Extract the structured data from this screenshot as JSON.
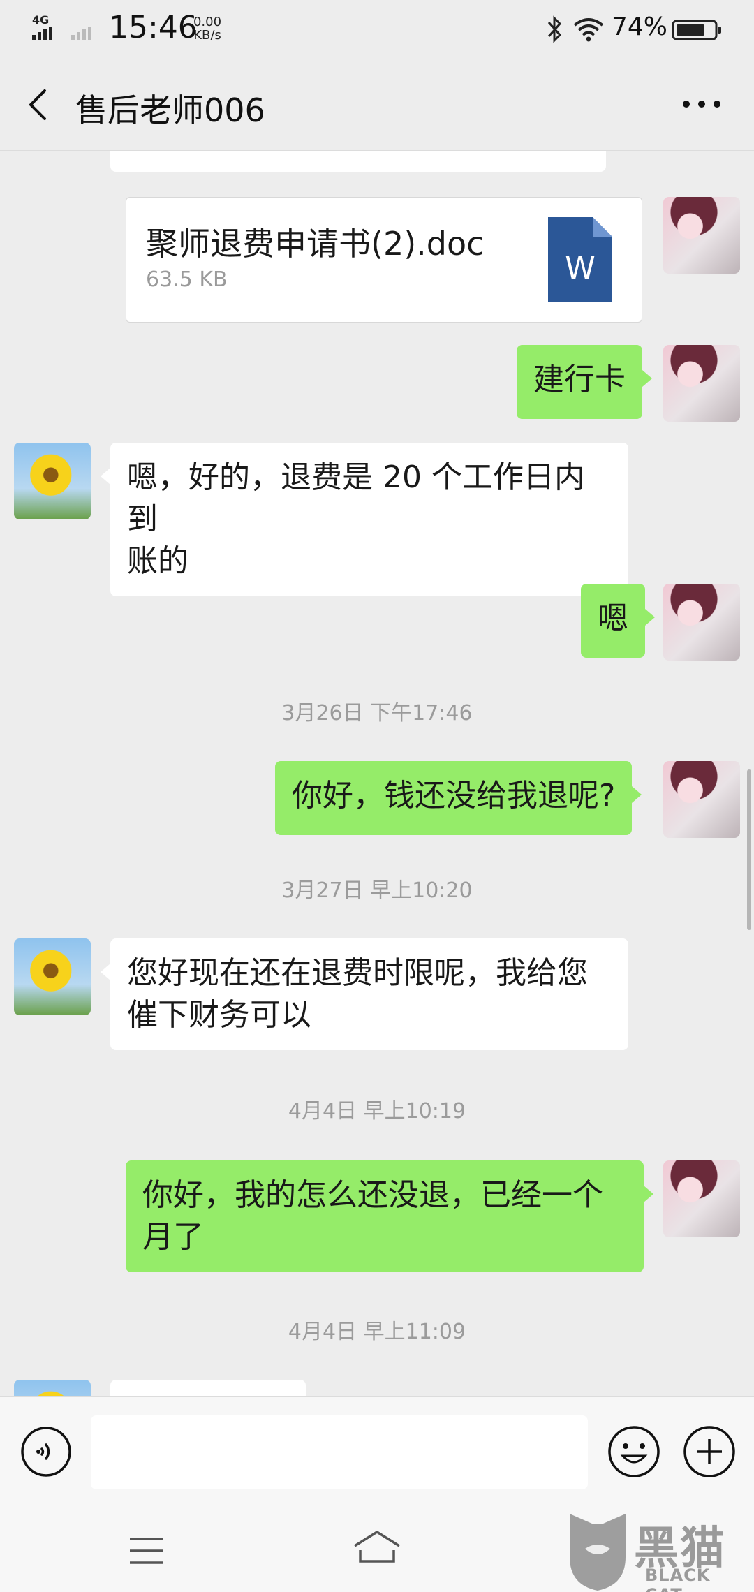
{
  "status_bar": {
    "network": "4G",
    "time": "15:46",
    "speed_value": "0.00",
    "speed_unit": "KB/s",
    "battery_percent": "74%"
  },
  "nav": {
    "title": "售后老师006",
    "back_icon": "chevron-left-icon",
    "more_icon": "more-dots-icon"
  },
  "messages": [
    {
      "type": "file",
      "side": "right",
      "file_name": "聚师退费申请书(2).doc",
      "file_size": "63.5 KB",
      "file_icon": "W"
    },
    {
      "type": "text",
      "side": "right",
      "lines": [
        "建行卡"
      ]
    },
    {
      "type": "text",
      "side": "left",
      "lines": [
        "嗯，好的，退费是 20 个工作日内到",
        "账的"
      ]
    },
    {
      "type": "text",
      "side": "right",
      "lines": [
        "嗯"
      ]
    },
    {
      "type": "time",
      "text": "3月26日 下午17:46"
    },
    {
      "type": "text",
      "side": "right",
      "lines": [
        "你好，钱还没给我退呢?"
      ]
    },
    {
      "type": "time",
      "text": "3月27日 早上10:20"
    },
    {
      "type": "text",
      "side": "left",
      "lines": [
        "您好现在还在退费时限呢，我给您",
        "催下财务可以"
      ]
    },
    {
      "type": "time",
      "text": "4月4日 早上10:19"
    },
    {
      "type": "text",
      "side": "right",
      "lines": [
        "你好，我的怎么还没退，已经一个",
        "月了"
      ]
    },
    {
      "type": "time",
      "text": "4月4日 早上11:09"
    }
  ],
  "input_bar": {
    "voice_icon": "voice-icon",
    "emoji_icon": "emoji-icon",
    "plus_icon": "plus-icon",
    "value": ""
  },
  "system_nav": {
    "menu_icon": "menu-icon",
    "home_icon": "home-icon"
  },
  "watermark": {
    "text": "黑猫",
    "sub": "BLACK CAT"
  },
  "colors": {
    "background": "#ededed",
    "my_bubble": "#95ec69",
    "their_bubble": "#ffffff",
    "doc_icon": "#2b5797"
  }
}
